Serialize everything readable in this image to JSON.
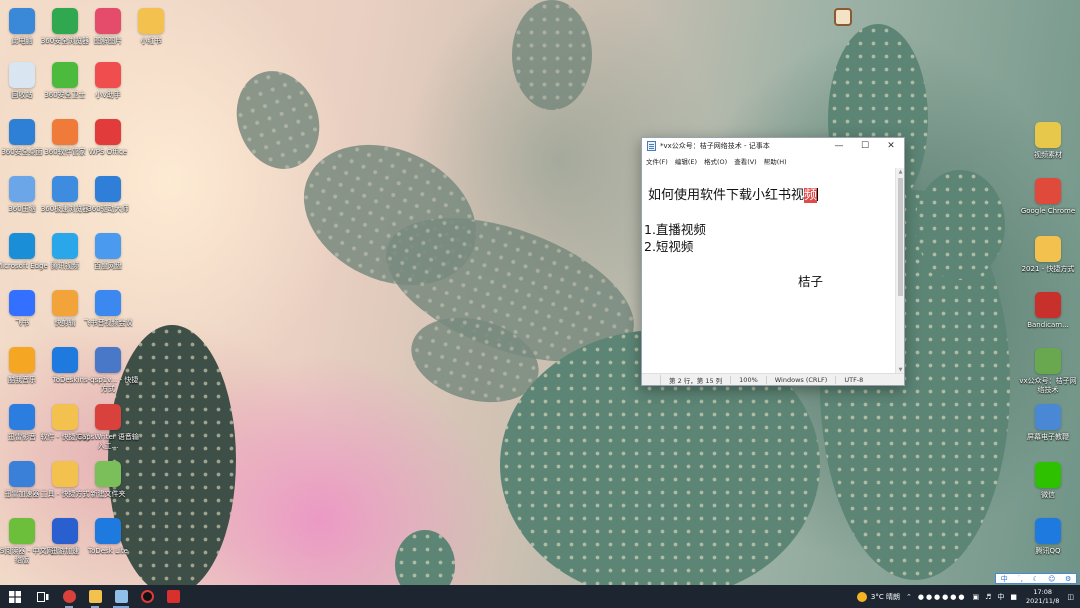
{
  "desktop_left": [
    {
      "label": "此电脑",
      "icon": "this-pc-icon",
      "color": "#3a88d8"
    },
    {
      "label": "360安全浏览器",
      "icon": "360-browser-icon",
      "color": "#2fa84f"
    },
    {
      "label": "图解图片",
      "icon": "image-viewer-icon",
      "color": "#e54b6b"
    },
    {
      "label": "小红书",
      "icon": "folder-icon",
      "color": "#f2c14e"
    },
    {
      "label": "回收站",
      "icon": "recycle-bin-icon",
      "color": "#d9e6f2"
    },
    {
      "label": "360安全卫士",
      "icon": "360-guard-icon",
      "color": "#4cba3c"
    },
    {
      "label": "小V助手",
      "icon": "assistant-icon",
      "color": "#f04e4e"
    },
    {
      "label": "360安全桌面",
      "icon": "360-desktop-icon",
      "color": "#2e7fd6"
    },
    {
      "label": "360软件管家",
      "icon": "360-software-icon",
      "color": "#f07a3a"
    },
    {
      "label": "WPS Office",
      "icon": "wps-icon",
      "color": "#e23b3b"
    },
    {
      "label": "360压缩",
      "icon": "360-zip-icon",
      "color": "#6aa6e8"
    },
    {
      "label": "360极速浏览器",
      "icon": "360-speed-browser-icon",
      "color": "#3d8ce0"
    },
    {
      "label": "360驱动大师",
      "icon": "360-driver-icon",
      "color": "#2f7ed8"
    },
    {
      "label": "Microsoft Edge",
      "icon": "edge-icon",
      "color": "#1a8fd8"
    },
    {
      "label": "腾讯视频",
      "icon": "tencent-video-icon",
      "color": "#2aa7ea"
    },
    {
      "label": "百度网盘",
      "icon": "baidu-netdisk-icon",
      "color": "#4a9bf0"
    },
    {
      "label": "飞书",
      "icon": "feishu-icon",
      "color": "#3370ff"
    },
    {
      "label": "快剪辑",
      "icon": "quick-edit-icon",
      "color": "#f2a33a"
    },
    {
      "label": "飞书音视频会议",
      "icon": "meeting-icon",
      "color": "#3a88f0"
    },
    {
      "label": "酷我音乐",
      "icon": "music-icon",
      "color": "#f5a623"
    },
    {
      "label": "ToDesk",
      "icon": "todesk-icon",
      "color": "#1f7ae0"
    },
    {
      "label": "ins-qsp1v... - 快捷方式",
      "icon": "shortcut-icon",
      "color": "#4a78c8"
    },
    {
      "label": "迅雷影音",
      "icon": "video-player-icon",
      "color": "#2b7de0"
    },
    {
      "label": "软件 - 快捷方式",
      "icon": "folder-icon",
      "color": "#f2c14e"
    },
    {
      "label": "CapsWriter 语音输入工...",
      "icon": "capswriter-icon",
      "color": "#d8413c"
    },
    {
      "label": "迅雷加速器",
      "icon": "accelerator-icon",
      "color": "#3a80d8"
    },
    {
      "label": "工具 - 快捷方式",
      "icon": "folder-icon",
      "color": "#f2c14e"
    },
    {
      "label": "新建文件夹",
      "icon": "folder-icon",
      "color": "#7bbf5a"
    },
    {
      "label": "RSS阅读器 - 中文网络版",
      "icon": "rss-icon",
      "color": "#6cbf3a"
    },
    {
      "label": "迅游加速",
      "icon": "game-accelerator-icon",
      "color": "#2a5fd0"
    },
    {
      "label": "ToDesk Lite",
      "icon": "todesk-lite-icon",
      "color": "#1f7ae0"
    }
  ],
  "desktop_right": [
    {
      "label": "视频素材",
      "icon": "folder-icon",
      "color": "#e8c84a"
    },
    {
      "label": "Google Chrome",
      "icon": "chrome-icon",
      "color": "#e04a3a"
    },
    {
      "label": "2021 - 快捷方式",
      "icon": "folder-icon",
      "color": "#f2c14e"
    },
    {
      "label": "Bandicam...",
      "icon": "bandicam-icon",
      "color": "#c8302c"
    },
    {
      "label": "vx公众号：桔子网络技术",
      "icon": "notepad-file-icon",
      "color": "#6aa84f"
    },
    {
      "label": "屏幕电子教鞭",
      "icon": "screen-pen-icon",
      "color": "#4a88d6"
    },
    {
      "label": "微信",
      "icon": "wechat-icon",
      "color": "#2dc100"
    },
    {
      "label": "腾讯QQ",
      "icon": "qq-icon",
      "color": "#1f7ae0"
    }
  ],
  "notepad": {
    "title": "*vx公众号：桔子网络技术 - 记事本",
    "menu": [
      "文件(F)",
      "编辑(E)",
      "格式(O)",
      "查看(V)",
      "帮助(H)"
    ],
    "lines": {
      "heading_pre": "如何使用软件下载小红书视",
      "heading_sel": "频",
      "item1": "1.直播视频",
      "item2": "2.短视频",
      "signature": "桔子"
    },
    "status": {
      "position": "第 2 行，第 15 列",
      "zoom": "100%",
      "eol": "Windows (CRLF)",
      "encoding": "UTF-8"
    }
  },
  "taskbar": {
    "weather": "3°C  晴朗",
    "time": "17:08",
    "date": "2021/11/8",
    "ime_lang": "中",
    "ime_bar": [
      "中",
      "˙,",
      "☾",
      "☺",
      "⚙"
    ]
  }
}
